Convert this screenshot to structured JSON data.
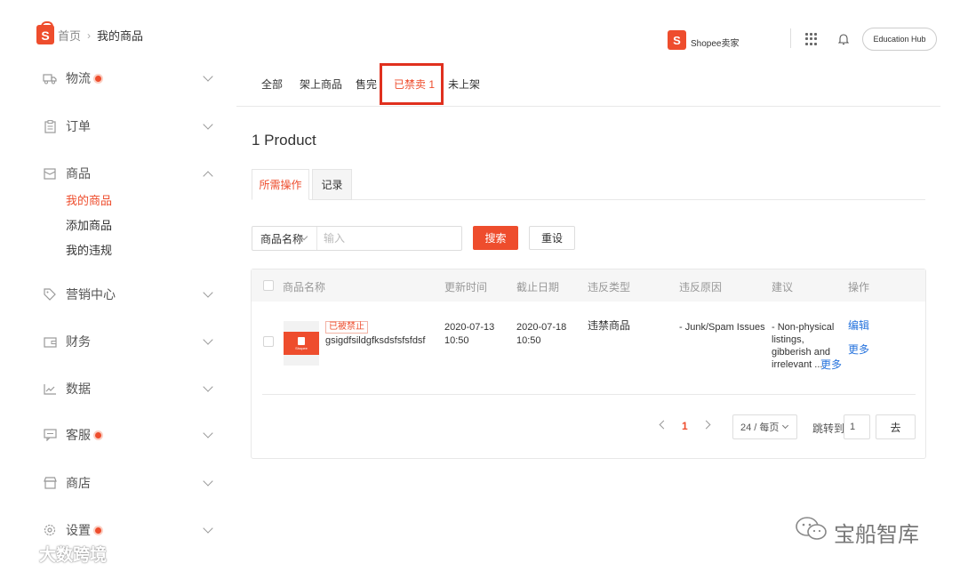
{
  "breadcrumb": {
    "home": "首页",
    "separator": "›",
    "current": "我的商品"
  },
  "sidebar": {
    "items": [
      {
        "label": "物流",
        "icon": "truck-icon",
        "badge": true
      },
      {
        "label": "订单",
        "icon": "clipboard-icon",
        "badge": false
      },
      {
        "label": "商品",
        "icon": "box-icon",
        "badge": false,
        "expanded": true,
        "children": [
          {
            "label": "我的商品",
            "active": true
          },
          {
            "label": "添加商品",
            "active": false
          },
          {
            "label": "我的违规",
            "active": false
          }
        ]
      },
      {
        "label": "营销中心",
        "icon": "tag-icon",
        "badge": false
      },
      {
        "label": "财务",
        "icon": "wallet-icon",
        "badge": false
      },
      {
        "label": "数据",
        "icon": "chart-icon",
        "badge": false
      },
      {
        "label": "客服",
        "icon": "chat-icon",
        "badge": true
      },
      {
        "label": "商店",
        "icon": "store-icon",
        "badge": false
      },
      {
        "label": "设置",
        "icon": "gear-icon",
        "badge": true
      }
    ]
  },
  "header": {
    "brand_logo_letter": "S",
    "shopee_seller_text": "Shopee卖家",
    "edu_hub_label": "Education Hub",
    "icons": [
      "apps-grid-icon",
      "bell-icon"
    ]
  },
  "main_tabs": [
    {
      "label": "全部",
      "active": false
    },
    {
      "label": "架上商品",
      "active": false
    },
    {
      "label": "售完",
      "active": false
    },
    {
      "label": "已禁卖 1",
      "active": true
    },
    {
      "label": "未上架",
      "active": false
    }
  ],
  "product_count": "1 Product",
  "sub_tabs": [
    {
      "label": "所需操作",
      "active": true
    },
    {
      "label": "记录",
      "active": false
    }
  ],
  "search": {
    "field_select": "商品名称",
    "placeholder": "输入",
    "search_label": "搜索",
    "reset_label": "重设"
  },
  "table": {
    "headers": [
      "商品名称",
      "更新时间",
      "截止日期",
      "违反类型",
      "违反原因",
      "建议",
      "操作"
    ],
    "rows": [
      {
        "status_tag": "已被禁止",
        "name": "gsigdfsildgfksdsfsfsfdsf",
        "thumb_text": "Shopee",
        "updated_date": "2020-07-13",
        "updated_time": "10:50",
        "deadline_date": "2020-07-18",
        "deadline_time": "10:50",
        "violation_type": "违禁商品",
        "violation_reason": "- Junk/Spam Issues",
        "suggestion_lines": [
          "- Non-physical",
          "listings,",
          "gibberish and",
          "irrelevant ..."
        ],
        "suggestion_more": "更多",
        "action_edit": "编辑",
        "action_more": "更多"
      }
    ]
  },
  "pagination": {
    "current_page": "1",
    "page_size": "24 / 每页",
    "jump_label": "跳转到",
    "jump_value": "1",
    "go_label": "去"
  },
  "watermarks": {
    "right": "宝船智库",
    "left": "大数跨境"
  },
  "colors": {
    "accent": "#ee4d2d",
    "link": "#2673dd",
    "highlight_box": "#e0301e"
  }
}
